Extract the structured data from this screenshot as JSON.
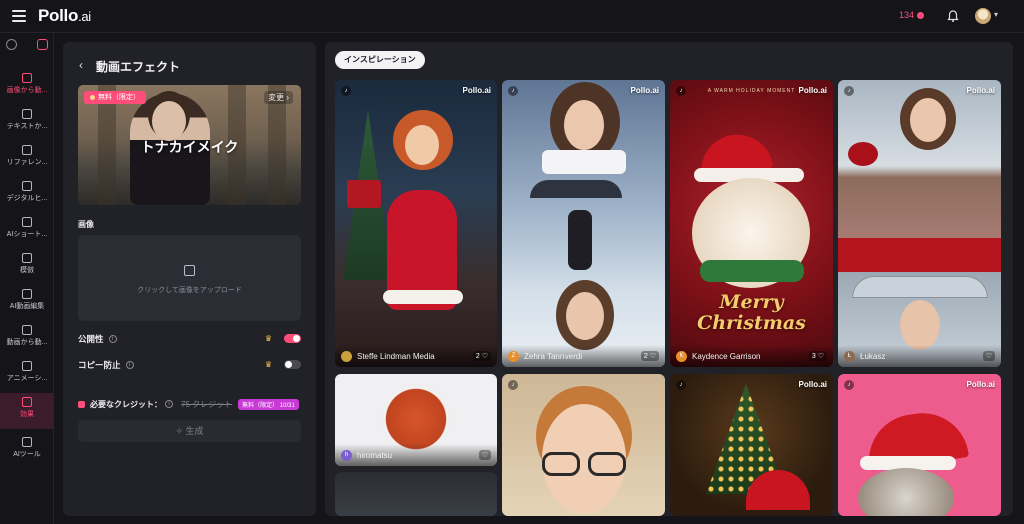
{
  "app": {
    "logo_main": "Pollo",
    "logo_suffix": ".ai",
    "credits": "134",
    "colors": {
      "accent": "#ff4d7a",
      "bg": "#141419",
      "panel": "#212128"
    }
  },
  "sidebar": {
    "items": [
      {
        "label": "画像から動...",
        "icon": "image-video-icon"
      },
      {
        "label": "テキストか...",
        "icon": "text-video-icon"
      },
      {
        "label": "リファレン...",
        "icon": "reference-icon"
      },
      {
        "label": "デジタルヒ...",
        "icon": "digital-human-icon"
      },
      {
        "label": "AIショート...",
        "icon": "short-video-icon"
      },
      {
        "label": "模倣",
        "icon": "imitate-icon"
      },
      {
        "label": "AI動画編集",
        "icon": "video-edit-icon"
      },
      {
        "label": "動画から動...",
        "icon": "video-to-video-icon"
      },
      {
        "label": "アニメーシ...",
        "icon": "animation-icon"
      },
      {
        "label": "効果",
        "icon": "effects-icon"
      },
      {
        "label": "AIツール",
        "icon": "ai-tools-icon"
      }
    ]
  },
  "panel": {
    "title": "動画エフェクト",
    "preview_badge": "無料（限定）",
    "change_label": "変更",
    "preview_label": "トナカイメイク",
    "image_section": "画像",
    "upload_text": "クリックして画像をアップロード",
    "public_label": "公開性",
    "copy_protect_label": "コピー防止",
    "public_on": true,
    "copy_protect_on": false,
    "credits_label": "必要なクレジット：",
    "credits_strike": "75 クレジット",
    "credits_free": "無料（限定） 10/31",
    "generate_label": "生成"
  },
  "gallery": {
    "tab": "インスピレーション",
    "watermark": "Pollo.ai",
    "cards": [
      {
        "user": "Steffe Lindman Media",
        "likes": "2",
        "avatar": ""
      },
      {
        "user": "Zehra Tanrıverdi",
        "likes": "2",
        "avatar": "Z"
      },
      {
        "user": "Kaydence Garrison",
        "likes": "3",
        "avatar": "K",
        "caption_top": "A WARM HOLIDAY MOMENT",
        "caption": "Merry Christmas"
      },
      {
        "user": "Łukasz",
        "likes": "",
        "avatar": "Ł"
      },
      {
        "user": "hiromatsu",
        "likes": "",
        "avatar": "h"
      }
    ]
  }
}
